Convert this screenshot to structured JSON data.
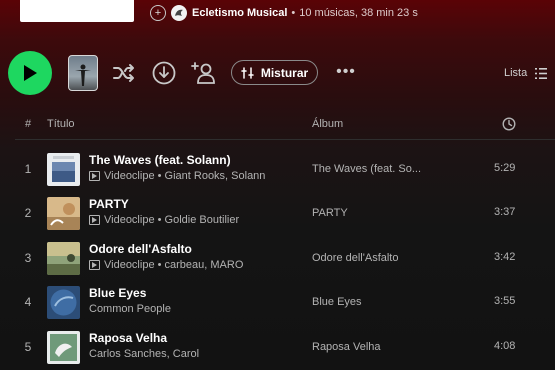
{
  "playlist": {
    "owner": "Ecletismo Musical",
    "separator": "•",
    "stats": "10 músicas, 38 min 23 s"
  },
  "controls": {
    "mix_label": "Misturar",
    "more_label": "•••",
    "list_label": "Lista"
  },
  "table_header": {
    "num": "#",
    "title": "Título",
    "album": "Álbum"
  },
  "tracks": [
    {
      "num": "1",
      "title": "The Waves (feat. Solann)",
      "type": "Videoclipe",
      "artists": "Giant Rooks, Solann",
      "album": "The Waves (feat. So...",
      "duration": "5:29",
      "is_video": true
    },
    {
      "num": "2",
      "title": "PARTY",
      "type": "Videoclipe",
      "artists": "Goldie Boutilier",
      "album": "PARTY",
      "duration": "3:37",
      "is_video": true
    },
    {
      "num": "3",
      "title": "Odore dell'Asfalto",
      "type": "Videoclipe",
      "artists": "carbeau, MARO",
      "album": "Odore dell'Asfalto",
      "duration": "3:42",
      "is_video": true
    },
    {
      "num": "4",
      "title": "Blue Eyes",
      "type": "",
      "artists": "Common People",
      "album": "Blue Eyes",
      "duration": "3:55",
      "is_video": false
    },
    {
      "num": "5",
      "title": "Raposa Velha",
      "type": "",
      "artists": "Carlos Sanches, Carol",
      "album": "Raposa Velha",
      "duration": "4:08",
      "is_video": false
    }
  ],
  "colors": {
    "accent": "#1ed760",
    "header_red": "#5a0306",
    "background": "#121212"
  }
}
